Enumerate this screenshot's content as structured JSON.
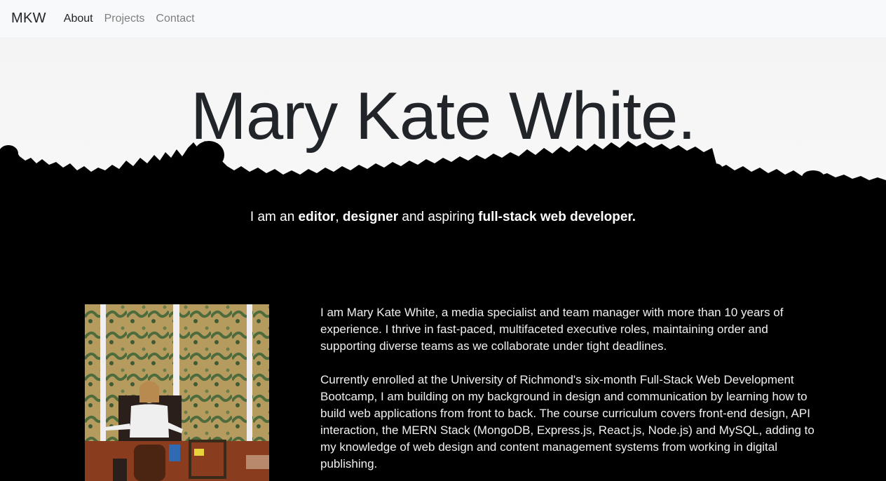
{
  "nav": {
    "brand": "MKW",
    "links": [
      {
        "label": "About",
        "active": true
      },
      {
        "label": "Projects",
        "active": false
      },
      {
        "label": "Contact",
        "active": false
      }
    ]
  },
  "hero": {
    "title": "Mary Kate White.",
    "tagline": {
      "p1": "I am an ",
      "b1": "editor",
      "p2": ", ",
      "b2": "designer",
      "p3": " and aspiring ",
      "b3": "full-stack web developer."
    }
  },
  "about": {
    "paragraphs": [
      "I am Mary Kate White, a media specialist and team manager with more than 10 years of experience. I thrive in fast-paced, multifaceted executive roles, maintaining order and supporting diverse teams as we collaborate under tight deadlines.",
      "Currently enrolled at the University of Richmond's six-month Full-Stack Web Development Bootcamp, I am building on my background in design and communication by learning how to build web applications from front to back. The course curriculum covers front-end design, API interaction, the MERN Stack (MongoDB, Express.js, React.js, Node.js) and MySQL, adding to my knowledge of web design and content management systems from working in digital publishing."
    ]
  },
  "colors": {
    "navbar_bg": "#f8f9fa",
    "page_bg": "#000000",
    "title": "#212529",
    "nav_muted": "#7f7f7f"
  }
}
